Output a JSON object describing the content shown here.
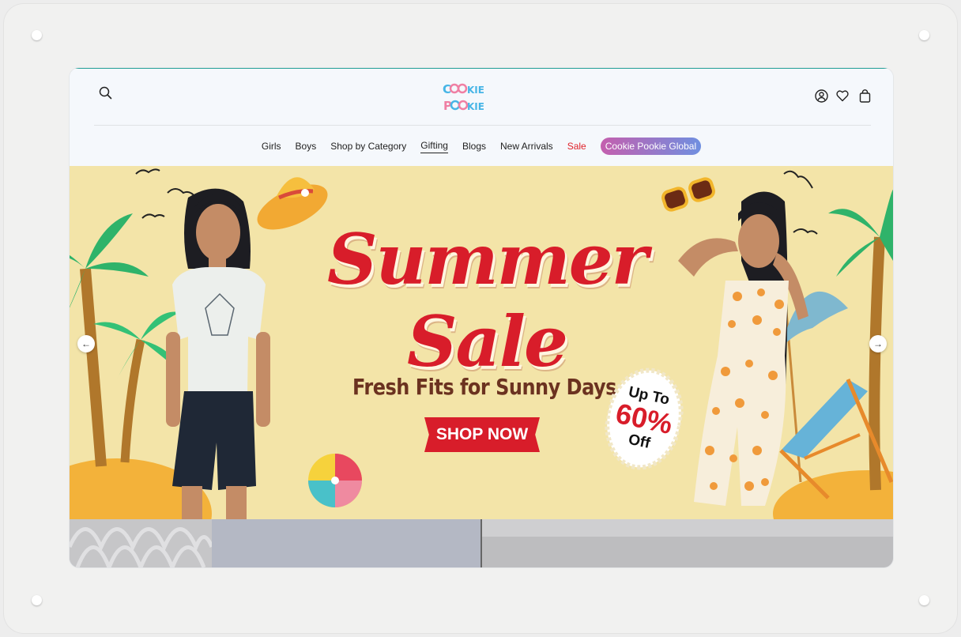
{
  "colors": {
    "accent": "#2aa39a",
    "sale": "#e0222a",
    "headline_red": "#d81d2a",
    "hero_bg": "#f3e4a8",
    "pill_gradient_start": "#c45fae",
    "pill_gradient_end": "#6f8fe0"
  },
  "header": {
    "search_icon": "search-icon",
    "logo_text": "COOKIE POOKIE",
    "account_icon": "user-circle-icon",
    "wishlist_icon": "heart-icon",
    "cart_icon": "shopping-bag-icon"
  },
  "nav": {
    "items": [
      {
        "label": "Girls"
      },
      {
        "label": "Boys"
      },
      {
        "label": "Shop by Category"
      },
      {
        "label": "Gifting",
        "active": true
      },
      {
        "label": "Blogs"
      },
      {
        "label": "New Arrivals"
      },
      {
        "label": "Sale",
        "highlight": "sale"
      },
      {
        "label": "Cookie Pookie Global",
        "style": "pill"
      }
    ]
  },
  "hero": {
    "headline": "Summer Sale",
    "subline": "Fresh Fits for Sunny Days",
    "cta_label": "SHOP NOW",
    "badge": {
      "top": "Up To",
      "value": "60%",
      "bottom": "Off"
    },
    "prev_icon": "arrow-left-icon",
    "next_icon": "arrow-right-icon",
    "prev_symbol": "←",
    "next_symbol": "→"
  }
}
